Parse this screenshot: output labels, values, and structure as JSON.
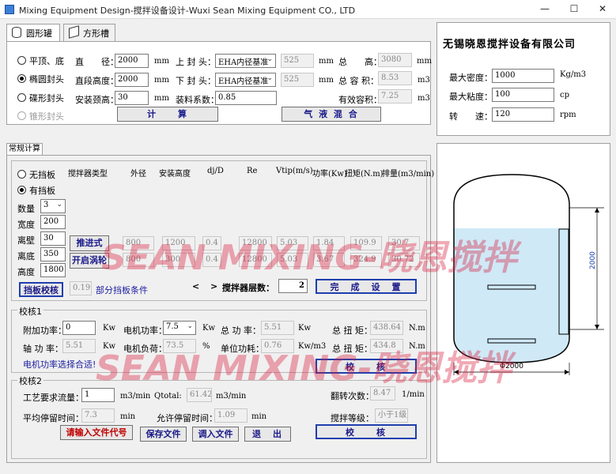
{
  "window": {
    "title": "Mixing Equipment Design-搅拌设备设计-Wuxi Sean Mixing Equipment CO., LTD",
    "min": "—",
    "max": "☐",
    "close": "✕"
  },
  "tabs": [
    "圆形罐",
    "方形槽"
  ],
  "vessel": {
    "head_options": [
      "平顶、底",
      "椭圆封头",
      "碟形封头",
      "锥形封头"
    ],
    "selected_head": 1,
    "diameter_label": "直　　径：",
    "diameter": "2000",
    "diameter_unit": "mm",
    "height_label": "直段高度：",
    "height": "2000",
    "height_unit": "mm",
    "neck_label": "安装颈高：",
    "neck": "30",
    "neck_unit": "mm",
    "top_head_label": "上 封 头：",
    "top_head": "EHA内径基准",
    "top_head_val": "525",
    "top_head_unit": "mm",
    "bottom_head_label": "下 封 头：",
    "bottom_head": "EHA内径基准",
    "bottom_head_val": "525",
    "bottom_head_unit": "mm",
    "fill_label": "装料系数：",
    "fill": "0.85",
    "total_height_label": "总　　高：",
    "total_height": "3080",
    "total_height_unit": "mm",
    "total_volume_label": "总 容 积：",
    "total_volume": "8.53",
    "total_volume_unit": "m3",
    "eff_volume_label": "有效容积：",
    "eff_volume": "7.25",
    "eff_volume_unit": "m3",
    "calc_btn": "计　　算",
    "gas_btn": "气 液 混 合"
  },
  "company": {
    "name": "无锡晓恩搅拌设备有限公司",
    "density_label": "最大密度：",
    "density": "1000",
    "density_unit": "Kg/m3",
    "viscosity_label": "最大粘度：",
    "viscosity": "100",
    "viscosity_unit": "cp",
    "speed_label": "转　　速：",
    "speed": "120",
    "speed_unit": "rpm"
  },
  "routine": {
    "tab": "常规计算",
    "baffle_options": [
      "无挡板",
      "有挡板"
    ],
    "selected_baffle": 1,
    "headers": [
      "搅拌器类型",
      "外径",
      "安装高度",
      "dj/D",
      "Re",
      "Vtip(m/s)",
      "功率(Kw)",
      "扭矩(N.m)",
      "排量(m3/min)"
    ],
    "qty_label": "数量",
    "qty": "3",
    "width_label": "宽度",
    "width": "200",
    "wall_label": "离壁",
    "wall": "30",
    "bottom_label": "离底",
    "bottom": "350",
    "hgt_label": "高度",
    "hgt": "1800",
    "rows": [
      {
        "type": "推进式",
        "d": "800",
        "h": "1200",
        "ratio": "0.4",
        "re": "12800",
        "vtip": "5.03",
        "power": "1.84",
        "torque": "109.9",
        "flow": "30.7"
      },
      {
        "type": "开启涡轮",
        "d": "800",
        "h": "300",
        "ratio": "0.4",
        "re": "12800",
        "vtip": "5.03",
        "power": "3.67",
        "torque": "324.9",
        "flow": "30.72"
      }
    ],
    "baffle_check_btn": "挡板校核",
    "baffle_val": "0.19",
    "baffle_cond": "部分挡板条件",
    "prev": "<",
    "next": ">",
    "layers_label": "搅拌器层数：",
    "layers": "2",
    "done_btn": "完　成　设　置"
  },
  "check1": {
    "title": "校核1",
    "extra_power_label": "附加功率：",
    "extra_power": "0",
    "extra_power_unit": "Kw",
    "motor_label": "电机功率：",
    "motor": "7.5",
    "motor_unit": "Kw",
    "total_power_label": "总 功 率：",
    "total_power": "5.51",
    "total_power_unit": "Kw",
    "total_torque_label": "总 扭 矩：",
    "total_torque": "438.64",
    "total_torque_unit": "N.m",
    "shaft_power_label": "轴 功 率：",
    "shaft_power": "5.51",
    "shaft_power_unit": "Kw",
    "load_label": "电机负荷：",
    "load": "73.5",
    "load_unit": "%",
    "unit_power_label": "单位功耗：",
    "unit_power": "0.76",
    "unit_power_unit": "Kw/m3",
    "torque2_label": "总 扭 矩：",
    "torque2": "434.8",
    "torque2_unit": "N.m",
    "ok_msg": "电机功率选择合适!",
    "check_btn": "校　　核"
  },
  "check2": {
    "title": "校核2",
    "flow_label": "工艺要求流量：",
    "flow": "1",
    "flow_unit": "m3/min",
    "qtotal_label": "Qtotal:",
    "qtotal": "61.42",
    "qtotal_unit": "m3/min",
    "turnover_label": "翻转次数：",
    "turnover": "8.47",
    "turnover_unit": "1/min",
    "avg_time_label": "平均停留时间：",
    "avg_time": "7.3",
    "avg_time_unit": "min",
    "allow_time_label": "允许停留时间：",
    "allow_time": "1.09",
    "allow_time_unit": "min",
    "grade_label": "搅拌等级：",
    "grade": "小于1级",
    "file_btn": "请输入文件代号",
    "save_btn": "保存文件",
    "load_btn": "调入文件",
    "exit_btn": "退　出",
    "check_btn": "校　　核"
  },
  "drawing": {
    "height_dim": "2000",
    "dia_dim": "Φ2000",
    "colors": {
      "liquid": "#cfe9f7",
      "stroke": "#000000"
    }
  },
  "watermark": "SEAN MIXING-晓恩搅拌"
}
